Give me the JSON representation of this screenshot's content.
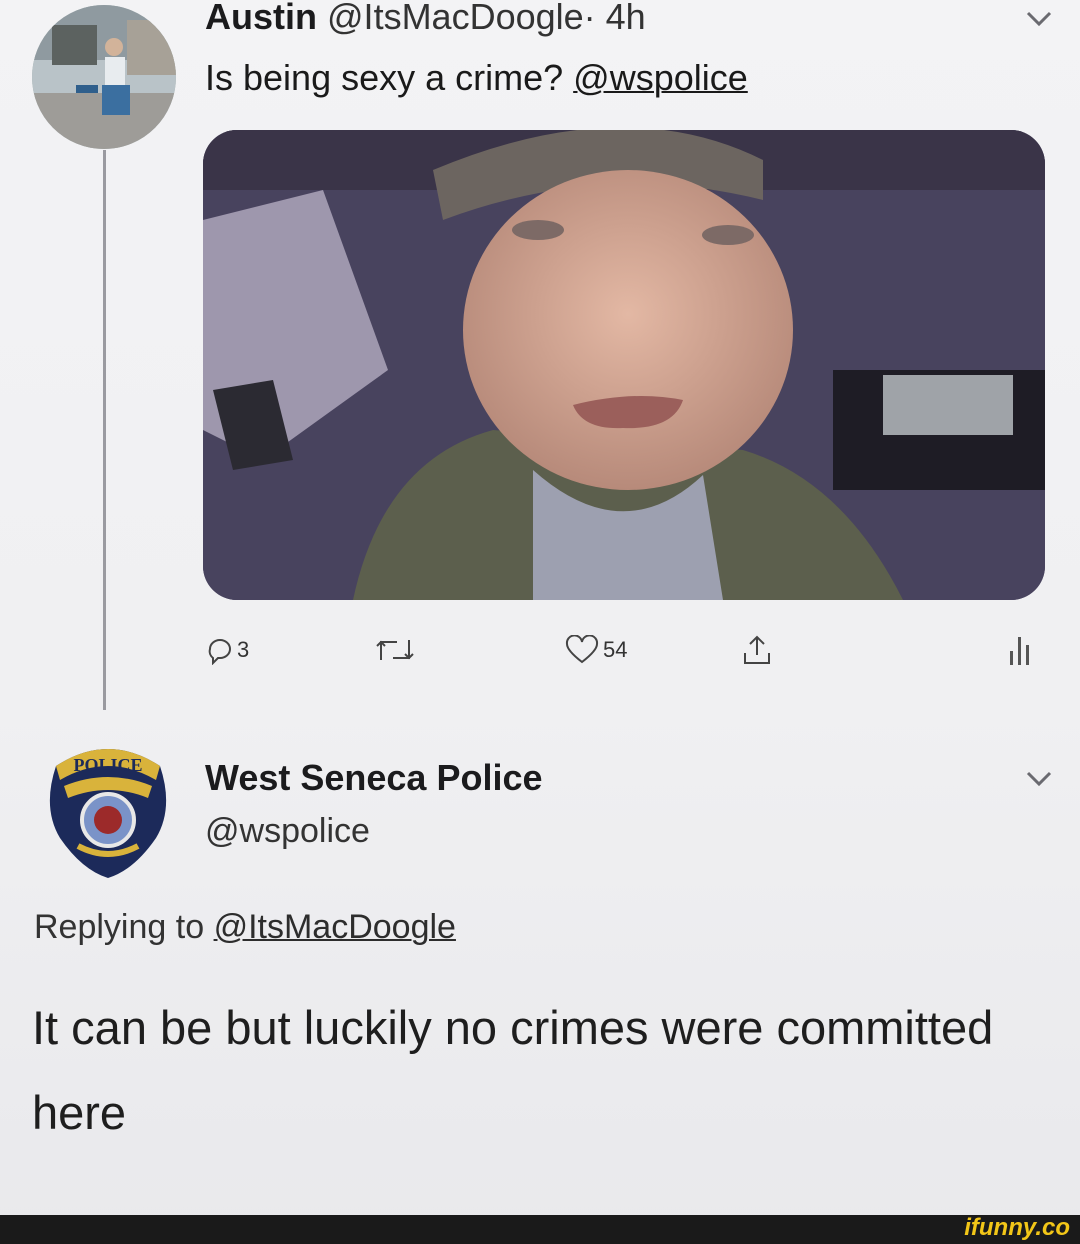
{
  "tweet": {
    "author_name": "Austin",
    "author_handle": "@ItsMacDoogle",
    "time": "· 4h",
    "text": "Is being sexy a crime?",
    "mention": "@wspolice",
    "actions": {
      "replies": "3",
      "likes": "54"
    }
  },
  "reply": {
    "author_name": "West Seneca Police",
    "author_handle": "@wspolice",
    "replying_prefix": "Replying to",
    "replying_handle": "@ItsMacDoogle",
    "text": "It can be but luckily no crimes were committed here",
    "badge_text": "POLICE"
  },
  "watermark": "ifunny.co",
  "colors": {
    "background": "#f0f0f2",
    "text": "#1b1b1d",
    "footer": "#1a1a1a",
    "watermark": "#f2c618"
  },
  "icons": [
    "chevron-down-icon",
    "reply-icon",
    "retweet-icon",
    "heart-icon",
    "share-icon",
    "analytics-icon"
  ]
}
